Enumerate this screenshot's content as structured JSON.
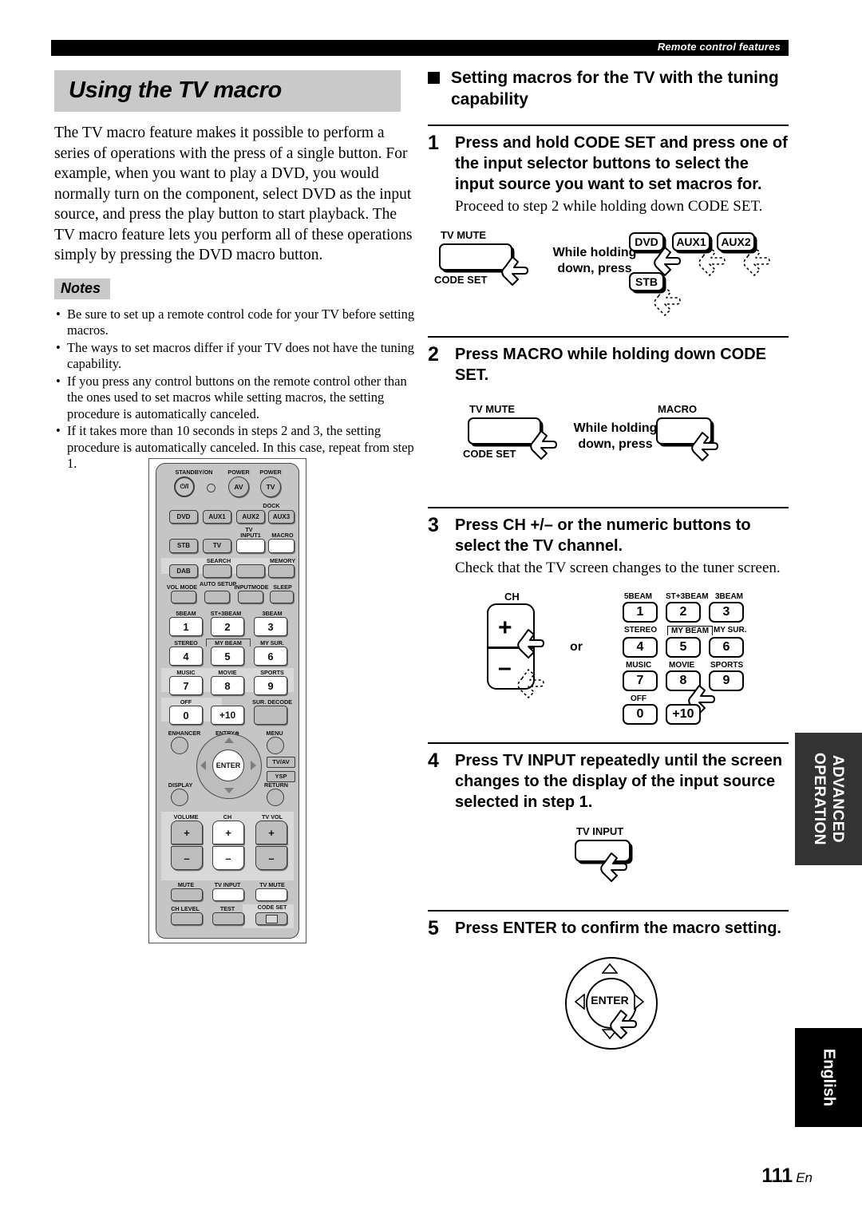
{
  "running_head": "Remote control features",
  "left": {
    "title": "Using the TV macro",
    "intro": "The TV macro feature makes it possible to perform a series of operations with the press of a single button. For example, when you want to play a DVD, you would normally turn on the component, select DVD as the input source, and press the play button to start playback. The TV macro feature lets you perform all of these operations simply by pressing the DVD macro button.",
    "notes_label": "Notes",
    "notes": [
      "Be sure to set up a remote control code for your TV before setting macros.",
      "The ways to set macros differ if your TV does not have the tuning capability.",
      "If you press any control buttons on the remote control other than the ones used to set macros while setting macros, the setting procedure is automatically canceled.",
      "If it takes more than 10 seconds in steps 2 and 3, the setting procedure is automatically canceled. In this case, repeat from step 1."
    ]
  },
  "right": {
    "section_title": "Setting macros for the TV with the tuning capability",
    "steps": [
      {
        "num": "1",
        "heading": "Press and hold CODE SET and press one of the input selector buttons to select the input source you want to set macros for.",
        "sub": "Proceed to step 2 while holding down CODE SET."
      },
      {
        "num": "2",
        "heading": "Press MACRO while holding down CODE SET.",
        "sub": ""
      },
      {
        "num": "3",
        "heading": "Press CH +/– or the numeric buttons to select the TV channel.",
        "sub": "Check that the TV screen changes to the tuner screen."
      },
      {
        "num": "4",
        "heading": "Press TV INPUT repeatedly until the screen changes to the display of the input source selected in step 1.",
        "sub": ""
      },
      {
        "num": "5",
        "heading": "Press ENTER to confirm the macro setting.",
        "sub": ""
      }
    ]
  },
  "figures": {
    "while_holding": "While holding\ndown, press",
    "or": "or",
    "fig1": {
      "tv_mute": "TV MUTE",
      "code_set": "CODE SET",
      "targets": [
        "DVD",
        "AUX1",
        "AUX2",
        "STB"
      ]
    },
    "fig2": {
      "tv_mute": "TV MUTE",
      "code_set": "CODE SET",
      "macro": "MACRO"
    },
    "fig3": {
      "ch": "CH",
      "plus": "+",
      "minus": "–",
      "keypad": [
        {
          "label": "5BEAM",
          "key": "1"
        },
        {
          "label": "ST+3BEAM",
          "key": "2"
        },
        {
          "label": "3BEAM",
          "key": "3"
        },
        {
          "label": "STEREO",
          "key": "4"
        },
        {
          "label": "MY BEAM",
          "key": "5"
        },
        {
          "label": "MY SUR.",
          "key": "6"
        },
        {
          "label": "MUSIC",
          "key": "7"
        },
        {
          "label": "MOVIE",
          "key": "8"
        },
        {
          "label": "SPORTS",
          "key": "9"
        },
        {
          "label": "OFF",
          "key": "0"
        },
        {
          "label": "",
          "key": "+10"
        }
      ]
    },
    "fig4": {
      "tv_input": "TV INPUT"
    },
    "fig5": {
      "enter": "ENTER"
    }
  },
  "remote": {
    "power_labels": {
      "standby": "STANDBY/ON",
      "power_av": "POWER",
      "power_tv": "POWER",
      "av": "AV",
      "tv": "TV",
      "standby_glyph": "⏻/I"
    },
    "row_inputs": [
      "DVD",
      "AUX1",
      "AUX2",
      "AUX3"
    ],
    "dock_label": "DOCK",
    "row2": [
      "STB",
      "TV",
      "",
      ""
    ],
    "row2_labels": {
      "tv": "TV",
      "input1": "INPUT1",
      "macro": "MACRO"
    },
    "row3": {
      "dab": "DAB",
      "search": "SEARCH",
      "memory": "MEMORY"
    },
    "row4_labels": [
      "VOL MODE",
      "AUTO SETUP",
      "INPUTMODE",
      "SLEEP"
    ],
    "numpad": [
      {
        "label": "5BEAM",
        "key": "1"
      },
      {
        "label": "ST+3BEAM",
        "key": "2"
      },
      {
        "label": "3BEAM",
        "key": "3"
      },
      {
        "label": "STEREO",
        "key": "4"
      },
      {
        "label": "MY BEAM",
        "key": "5"
      },
      {
        "label": "MY SUR.",
        "key": "6"
      },
      {
        "label": "MUSIC",
        "key": "7"
      },
      {
        "label": "MOVIE",
        "key": "8"
      },
      {
        "label": "SPORTS",
        "key": "9"
      },
      {
        "label": "OFF",
        "key": "0"
      },
      {
        "label": "",
        "key": "+10"
      },
      {
        "label": "SUR. DECODE",
        "key": ""
      }
    ],
    "nav": {
      "enhancer": "ENHANCER",
      "entry": "ENTRY⊕",
      "menu": "MENU",
      "enter": "ENTER",
      "display": "DISPLAY",
      "return": "RETURN",
      "tv_av": "TV/AV",
      "ysp": "YSP"
    },
    "volume_block": {
      "volume": "VOLUME",
      "ch": "CH",
      "tv_vol": "TV VOL",
      "plus": "+",
      "minus": "–"
    },
    "bottom": {
      "mute": "MUTE",
      "tv_input": "TV INPUT",
      "tv_mute": "TV MUTE",
      "ch_level": "CH LEVEL",
      "test": "TEST",
      "code_set": "CODE SET"
    }
  },
  "tabs": {
    "advanced": "ADVANCED\nOPERATION",
    "english": "English"
  },
  "folio": {
    "page": "111",
    "lang": "En"
  }
}
